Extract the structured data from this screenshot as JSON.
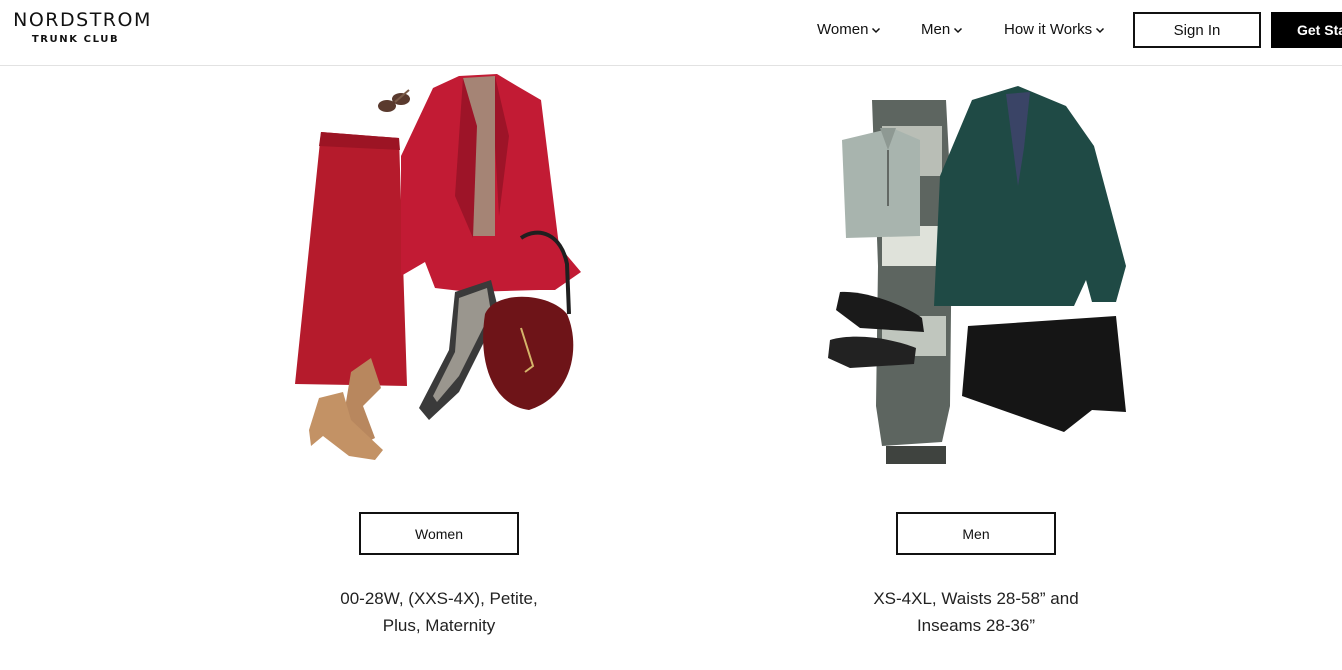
{
  "brand": {
    "name": "NORDSTROM",
    "sub": "TRUNK CLUB"
  },
  "nav": {
    "items": [
      {
        "label": "Women",
        "icon": "chevron-down-icon"
      },
      {
        "label": "Men",
        "icon": "chevron-down-icon"
      },
      {
        "label": "How it Works",
        "icon": "chevron-down-icon"
      }
    ],
    "sign_in": "Sign In",
    "get_started": "Get Sta"
  },
  "panels": {
    "women": {
      "button_label": "Women",
      "sizes_line1": "00-28W, (XXS-4X), Petite,",
      "sizes_line2": "Plus, Maternity"
    },
    "men": {
      "button_label": "Men",
      "sizes_line1": "XS-4XL, Waists 28-58” and",
      "sizes_line2": "Inseams 28-36”"
    }
  },
  "colors": {
    "text": "#111111",
    "button_dark": "#000000",
    "divider": "#e2e2e2"
  }
}
